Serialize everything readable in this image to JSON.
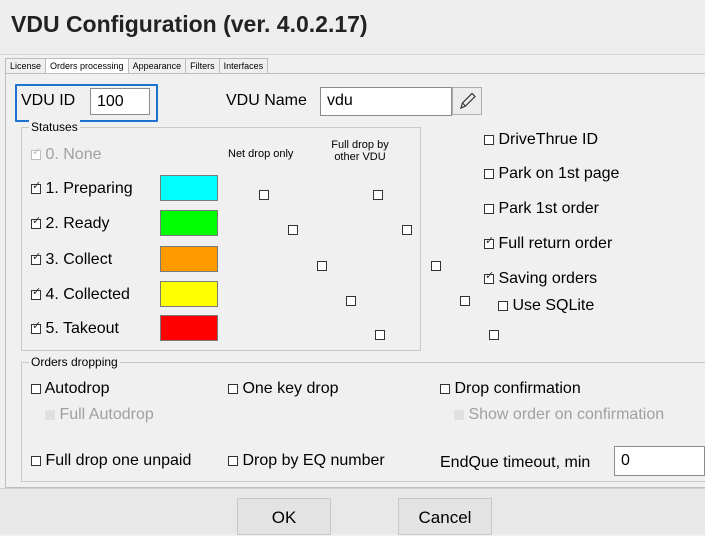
{
  "window": {
    "title": "VDU Configuration (ver. 4.0.2.17)"
  },
  "tabs": [
    {
      "label": "License"
    },
    {
      "label": "Orders processing"
    },
    {
      "label": "Appearance"
    },
    {
      "label": "Filters"
    },
    {
      "label": "Interfaces"
    }
  ],
  "vdu_id": {
    "label": "VDU ID",
    "value": "100"
  },
  "vdu_name": {
    "label": "VDU Name",
    "value": "vdu"
  },
  "statuses": {
    "legend": "Statuses",
    "col_net_drop": "Net drop only",
    "col_full_drop": "Full drop by other VDU",
    "items": [
      {
        "label": "0. None",
        "checked": true,
        "enabled": false,
        "color": ""
      },
      {
        "label": "1. Preparing",
        "checked": true,
        "enabled": true,
        "color": "#00ffff"
      },
      {
        "label": "2. Ready",
        "checked": true,
        "enabled": true,
        "color": "#00ff00"
      },
      {
        "label": "3. Collect",
        "checked": true,
        "enabled": true,
        "color": "#ff9900"
      },
      {
        "label": "4. Collected",
        "checked": true,
        "enabled": true,
        "color": "#ffff00"
      },
      {
        "label": "5. Takeout",
        "checked": true,
        "enabled": true,
        "color": "#ff0000"
      }
    ]
  },
  "options": {
    "drivethru": {
      "label": "DriveThrue ID",
      "checked": false
    },
    "park_first_page": {
      "label": "Park on 1st page",
      "checked": false
    },
    "park_first_order": {
      "label": "Park 1st order",
      "checked": false
    },
    "full_return": {
      "label": "Full return order",
      "checked": true
    },
    "saving_orders": {
      "label": "Saving orders",
      "checked": true
    },
    "use_sqlite": {
      "label": "Use SQLite",
      "checked": false
    }
  },
  "orders_dropping": {
    "legend": "Orders dropping",
    "autodrop": {
      "label": "Autodrop",
      "checked": false
    },
    "full_autodrop": {
      "label": "Full Autodrop",
      "checked": false
    },
    "one_key_drop": {
      "label": "One key drop",
      "checked": false
    },
    "drop_confirmation": {
      "label": "Drop confirmation",
      "checked": false
    },
    "show_order_confirmation": {
      "label": "Show order on confirmation",
      "checked": false
    },
    "full_drop_unpaid": {
      "label": "Full drop one unpaid",
      "checked": false
    },
    "drop_by_eq": {
      "label": "Drop by EQ number",
      "checked": false
    },
    "endque_timeout": {
      "label": "EndQue timeout, min",
      "value": "0"
    }
  },
  "buttons": {
    "ok": "OK",
    "cancel": "Cancel"
  },
  "icons": {
    "edit": "pencil-icon",
    "check": "☑",
    "uncheck": "☐"
  }
}
